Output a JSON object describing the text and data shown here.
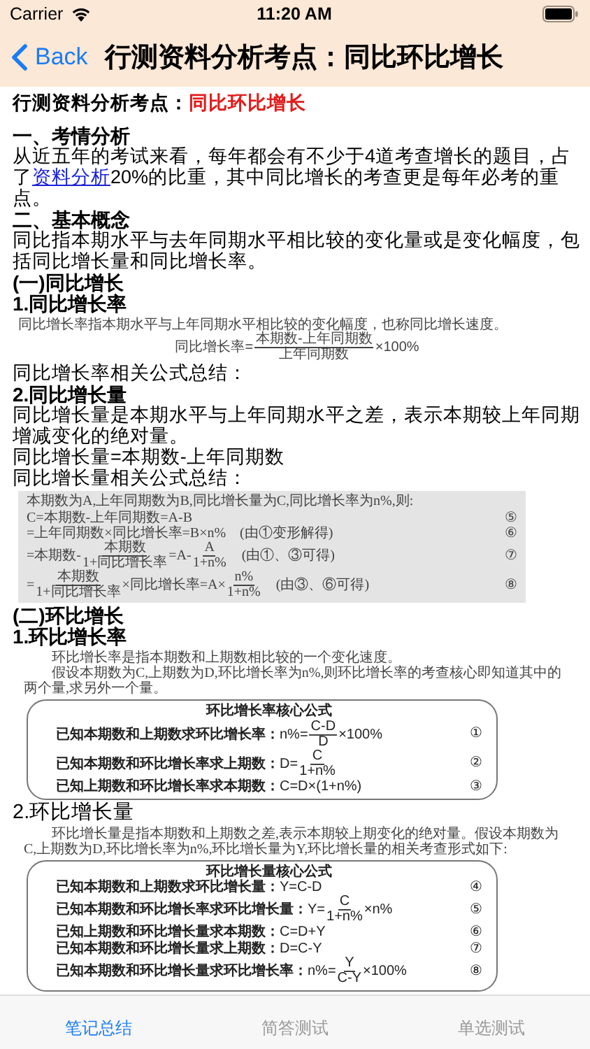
{
  "status_bar": {
    "carrier": "Carrier",
    "time": "11:20 AM"
  },
  "nav_bar": {
    "back_label": "Back",
    "title": "行测资料分析考点：同比环比增长"
  },
  "article": [
    {
      "kind": "title",
      "label": "行测资料分析考点：",
      "highlight": "同比环比增长"
    },
    {
      "kind": "heading",
      "text": "一、考情分析"
    },
    {
      "kind": "paragraph",
      "parts": [
        {
          "kind": "text",
          "text": "从近五年的考试来看，每年都会有不少于4道考查增长的题目，占了"
        },
        {
          "kind": "link",
          "text": "资料分析"
        },
        {
          "kind": "text",
          "text": "20%的比重，其中同比增长的考查更是每年必考的重点。"
        }
      ]
    },
    {
      "kind": "heading",
      "text": "二、基本概念"
    },
    {
      "kind": "paragraph",
      "parts": [
        {
          "kind": "text",
          "text": "同比指本期水平与去年同期水平相比较的变化量或是变化幅度，包括同比增长量和同比增长率。"
        }
      ]
    },
    {
      "kind": "heading",
      "text": "(一)同比增长"
    },
    {
      "kind": "heading",
      "text": "1.同比增长率"
    },
    {
      "kind": "figure_plain",
      "lines": [
        {
          "parts": [
            {
              "kind": "text",
              "text": "同比增长率指本期水平与上年同期水平相比较的变化幅度，也称同比增长速度。"
            }
          ]
        },
        {
          "kind": "centered",
          "parts": [
            {
              "kind": "text",
              "text": "同比增长率="
            },
            {
              "kind": "frac",
              "num": "本期数-上年同期数",
              "den": "上年同期数"
            },
            {
              "kind": "text",
              "text": "×100%"
            }
          ]
        }
      ]
    },
    {
      "kind": "paragraph",
      "parts": [
        {
          "kind": "text",
          "text": "同比增长率相关公式总结："
        }
      ]
    },
    {
      "kind": "heading",
      "text": "2.同比增长量"
    },
    {
      "kind": "paragraph",
      "parts": [
        {
          "kind": "text",
          "text": "同比增长量是本期水平与上年同期水平之差，表示本期较上年同期增减变化的绝对量。"
        }
      ]
    },
    {
      "kind": "paragraph",
      "parts": [
        {
          "kind": "text",
          "text": "同比增长量=本期数-上年同期数"
        }
      ]
    },
    {
      "kind": "paragraph",
      "parts": [
        {
          "kind": "text",
          "text": "同比增长量相关公式总结："
        }
      ]
    },
    {
      "kind": "figure_shaded",
      "lines": [
        {
          "parts": [
            {
              "kind": "text",
              "text": "本期数为A,上年同期数为B,同比增长量为C,同比增长率为n%,则:"
            }
          ]
        },
        {
          "number": "⑤",
          "parts": [
            {
              "kind": "text",
              "text": "C=本期数-上年同期数=A-B"
            }
          ]
        },
        {
          "number": "⑥",
          "parts": [
            {
              "kind": "text",
              "text": "=上年同期数×同比增长率=B×n%　(由①变形解得)"
            }
          ]
        },
        {
          "number": "⑦",
          "parts": [
            {
              "kind": "text",
              "text": "=本期数-"
            },
            {
              "kind": "frac",
              "num": "本期数",
              "den": "1+同比增长率"
            },
            {
              "kind": "text",
              "text": "=A-"
            },
            {
              "kind": "frac",
              "num": "A",
              "den": "1+n%"
            },
            {
              "kind": "text",
              "text": "　(由①、③可得)"
            }
          ]
        },
        {
          "number": "⑧",
          "parts": [
            {
              "kind": "text",
              "text": "="
            },
            {
              "kind": "frac",
              "num": "本期数",
              "den": "1+同比增长率"
            },
            {
              "kind": "text",
              "text": "×同比增长率=A×"
            },
            {
              "kind": "frac",
              "num": "n%",
              "den": "1+n%"
            },
            {
              "kind": "text",
              "text": "　(由③、⑥可得)"
            }
          ]
        }
      ]
    },
    {
      "kind": "heading",
      "text": "(二)环比增长"
    },
    {
      "kind": "heading",
      "text": "1.环比增长率"
    },
    {
      "kind": "figure_prose",
      "lines": [
        {
          "parts": [
            {
              "kind": "text",
              "text": "环比增长率是指本期数和上期数相比较的一个变化速度。"
            }
          ]
        },
        {
          "parts": [
            {
              "kind": "text",
              "text": "假设本期数为C,上期数为D,环比增长率为n%,则环比增长率的考查核心即知道其中的两个量,求另外一个量。"
            }
          ]
        }
      ]
    },
    {
      "kind": "formula_card",
      "title": "环比增长率核心公式",
      "lines": [
        {
          "number": "①",
          "parts": [
            {
              "kind": "bold",
              "text": "已知本期数和上期数求环比增长率："
            },
            {
              "kind": "text",
              "text": "n%="
            },
            {
              "kind": "frac",
              "num": "C-D",
              "den": "D"
            },
            {
              "kind": "text",
              "text": "×100%"
            }
          ]
        },
        {
          "number": "②",
          "parts": [
            {
              "kind": "bold",
              "text": "已知本期数和环比增长率求上期数："
            },
            {
              "kind": "text",
              "text": "D="
            },
            {
              "kind": "frac",
              "num": "C",
              "den": "1+n%"
            }
          ]
        },
        {
          "number": "③",
          "parts": [
            {
              "kind": "bold",
              "text": "已知上期数和环比增长率求本期数："
            },
            {
              "kind": "text",
              "text": "C=D×(1+n%)"
            }
          ]
        }
      ]
    },
    {
      "kind": "heading_light",
      "text": "2.环比增长量"
    },
    {
      "kind": "figure_prose",
      "lines": [
        {
          "parts": [
            {
              "kind": "text",
              "text": "环比增长量是指本期数和上期数之差,表示本期较上期变化的绝对量。假设本期数为C,上期数为D,环比增长率为n%,环比增长量为Y,环比增长量的相关考查形式如下:"
            }
          ]
        }
      ]
    },
    {
      "kind": "formula_card",
      "title": "环比增长量核心公式",
      "lines": [
        {
          "number": "④",
          "parts": [
            {
              "kind": "bold",
              "text": "已知本期数和上期数求环比增长量："
            },
            {
              "kind": "text",
              "text": "Y=C-D"
            }
          ]
        },
        {
          "number": "⑤",
          "parts": [
            {
              "kind": "bold",
              "text": "已知本期数和环比增长率求环比增长量："
            },
            {
              "kind": "text",
              "text": "Y="
            },
            {
              "kind": "frac",
              "num": "C",
              "den": "1+n%"
            },
            {
              "kind": "text",
              "text": "×n%"
            }
          ]
        },
        {
          "number": "⑥",
          "parts": [
            {
              "kind": "bold",
              "text": "已知上期数和环比增长量求本期数："
            },
            {
              "kind": "text",
              "text": "C=D+Y"
            }
          ]
        },
        {
          "number": "⑦",
          "parts": [
            {
              "kind": "bold",
              "text": "已知本期数和环比增长量求上期数："
            },
            {
              "kind": "text",
              "text": "D=C-Y"
            }
          ]
        },
        {
          "number": "⑧",
          "parts": [
            {
              "kind": "bold",
              "text": "已知本期数和环比增长量求环比增长率："
            },
            {
              "kind": "text",
              "text": "n%="
            },
            {
              "kind": "frac",
              "num": "Y",
              "den": "C-Y"
            },
            {
              "kind": "text",
              "text": "×100%"
            }
          ]
        }
      ]
    }
  ],
  "tab_bar": [
    {
      "label": "笔记总结",
      "selected": true
    },
    {
      "label": "简答测试",
      "selected": false
    },
    {
      "label": "单选测试",
      "selected": false
    }
  ]
}
